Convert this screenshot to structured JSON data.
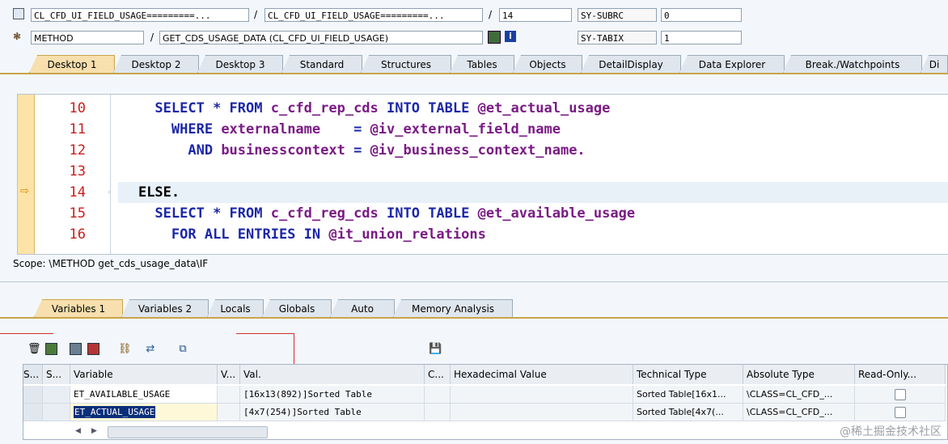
{
  "top": {
    "row1": {
      "class_field": "CL_CFD_UI_FIELD_USAGE=========...",
      "include_field": "CL_CFD_UI_FIELD_USAGE=========...",
      "line": "14",
      "sy_label": "SY-SUBRC",
      "sy_value": "0"
    },
    "row2": {
      "type": "METHOD",
      "method": "GET_CDS_USAGE_DATA (CL_CFD_UI_FIELD_USAGE)",
      "sy_label": "SY-TABIX",
      "sy_value": "1"
    },
    "sep": "/"
  },
  "tabs": [
    "Desktop 1",
    "Desktop 2",
    "Desktop 3",
    "Standard",
    "Structures",
    "Tables",
    "Objects",
    "DetailDisplay",
    "Data Explorer",
    "Break./Watchpoints",
    "Di"
  ],
  "code_lines": [
    {
      "num": "10",
      "indent": "      ",
      "parts": [
        [
          "kw",
          "SELECT * FROM "
        ],
        [
          "id",
          "c_cfd_rep_cds"
        ],
        [
          "kw",
          " INTO TABLE "
        ],
        [
          "id",
          "@et_actual_usage"
        ]
      ]
    },
    {
      "num": "11",
      "indent": "        ",
      "parts": [
        [
          "kw",
          "WHERE "
        ],
        [
          "id",
          "externalname"
        ],
        [
          "kw",
          "    = "
        ],
        [
          "id",
          "@iv_external_field_name"
        ]
      ]
    },
    {
      "num": "12",
      "indent": "          ",
      "parts": [
        [
          "kw",
          "AND "
        ],
        [
          "id",
          "businesscontext"
        ],
        [
          "kw",
          " = "
        ],
        [
          "id",
          "@iv_business_context_name."
        ]
      ]
    },
    {
      "num": "13",
      "indent": "",
      "parts": []
    },
    {
      "num": "14",
      "indent": "    ",
      "parts": [
        [
          "black",
          "ELSE."
        ]
      ]
    },
    {
      "num": "15",
      "indent": "      ",
      "parts": [
        [
          "kw",
          "SELECT * FROM "
        ],
        [
          "id",
          "c_cfd_reg_cds"
        ],
        [
          "kw",
          " INTO TABLE "
        ],
        [
          "id",
          "@et_available_usage"
        ]
      ]
    },
    {
      "num": "16",
      "indent": "        ",
      "parts": [
        [
          "kw",
          "FOR ALL ENTRIES IN "
        ],
        [
          "id",
          "@it_union_relations"
        ]
      ]
    }
  ],
  "scope": "Scope: \\METHOD get_cds_usage_data\\IF",
  "var_tabs": [
    "Variables 1",
    "Variables 2",
    "Locals",
    "Globals",
    "Auto",
    "Memory Analysis"
  ],
  "grid": {
    "headers": [
      "S...",
      "Variable",
      "V...",
      "Val.",
      "C...",
      "Hexadecimal Value",
      "Technical Type",
      "Absolute Type",
      "Read-Only..."
    ],
    "rows": [
      {
        "variable": "ET_AVAILABLE_USAGE",
        "value": "[16x13(892)]Sorted Table",
        "tech": "Sorted Table[16x1...",
        "abs": "\\CLASS=CL_CFD_..."
      },
      {
        "variable": "ET_ACTUAL_USAGE",
        "value": "[4x7(254)]Sorted Table",
        "tech": "Sorted Table[4x7(...",
        "abs": "\\CLASS=CL_CFD_..."
      }
    ]
  },
  "watermark": "@稀土掘金技术社区",
  "colors": {
    "keyword": "#1c27a8",
    "identifier": "#7a1b85",
    "line_number": "#c8201c",
    "active_tab": "#f7dfae"
  }
}
